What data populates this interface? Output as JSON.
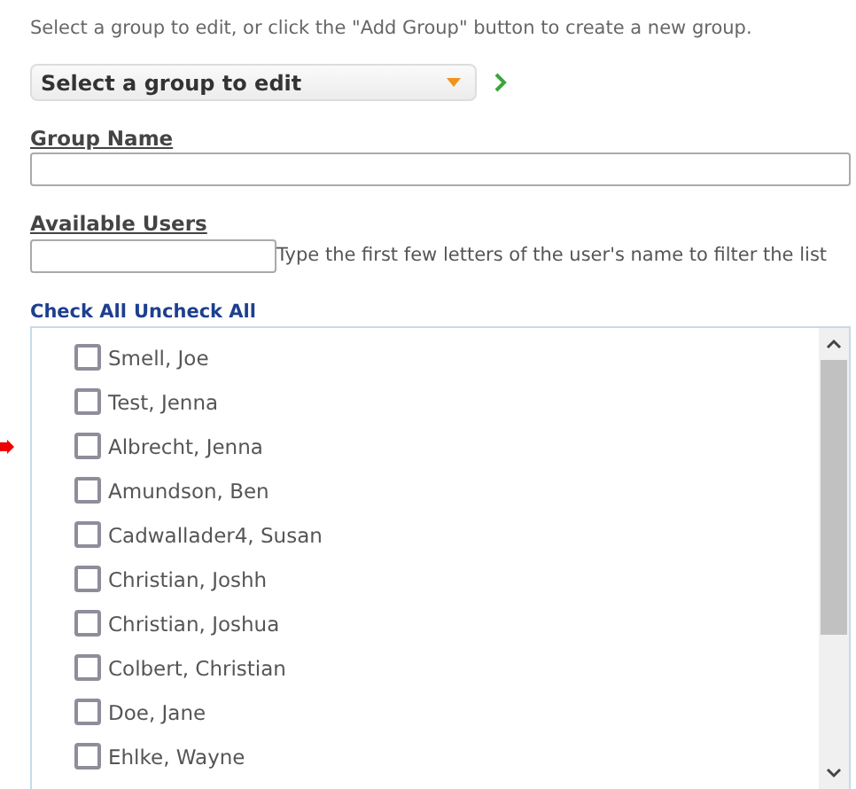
{
  "intro": "Select a group to edit, or click the \"Add Group\" button to create a new group.",
  "group_select": {
    "value": "Select a group to edit"
  },
  "group_name": {
    "label": "Group Name"
  },
  "available_users": {
    "label": "Available Users",
    "hint": "Type the first few letters of the user's name to filter the list"
  },
  "links": [
    "Check All",
    "Uncheck All"
  ],
  "users": [
    {
      "name": "Smell, Joe",
      "checked": false,
      "pointed": false
    },
    {
      "name": "Test, Jenna",
      "checked": false,
      "pointed": false
    },
    {
      "name": "Albrecht, Jenna",
      "checked": false,
      "pointed": true
    },
    {
      "name": "Amundson, Ben",
      "checked": false,
      "pointed": false
    },
    {
      "name": "Cadwallader4, Susan",
      "checked": false,
      "pointed": false
    },
    {
      "name": "Christian, Joshh",
      "checked": false,
      "pointed": false
    },
    {
      "name": "Christian, Joshua",
      "checked": false,
      "pointed": false
    },
    {
      "name": "Colbert, Christian",
      "checked": false,
      "pointed": false
    },
    {
      "name": "Doe, Jane",
      "checked": false,
      "pointed": false
    },
    {
      "name": "Ehlke, Wayne",
      "checked": false,
      "pointed": false
    }
  ]
}
